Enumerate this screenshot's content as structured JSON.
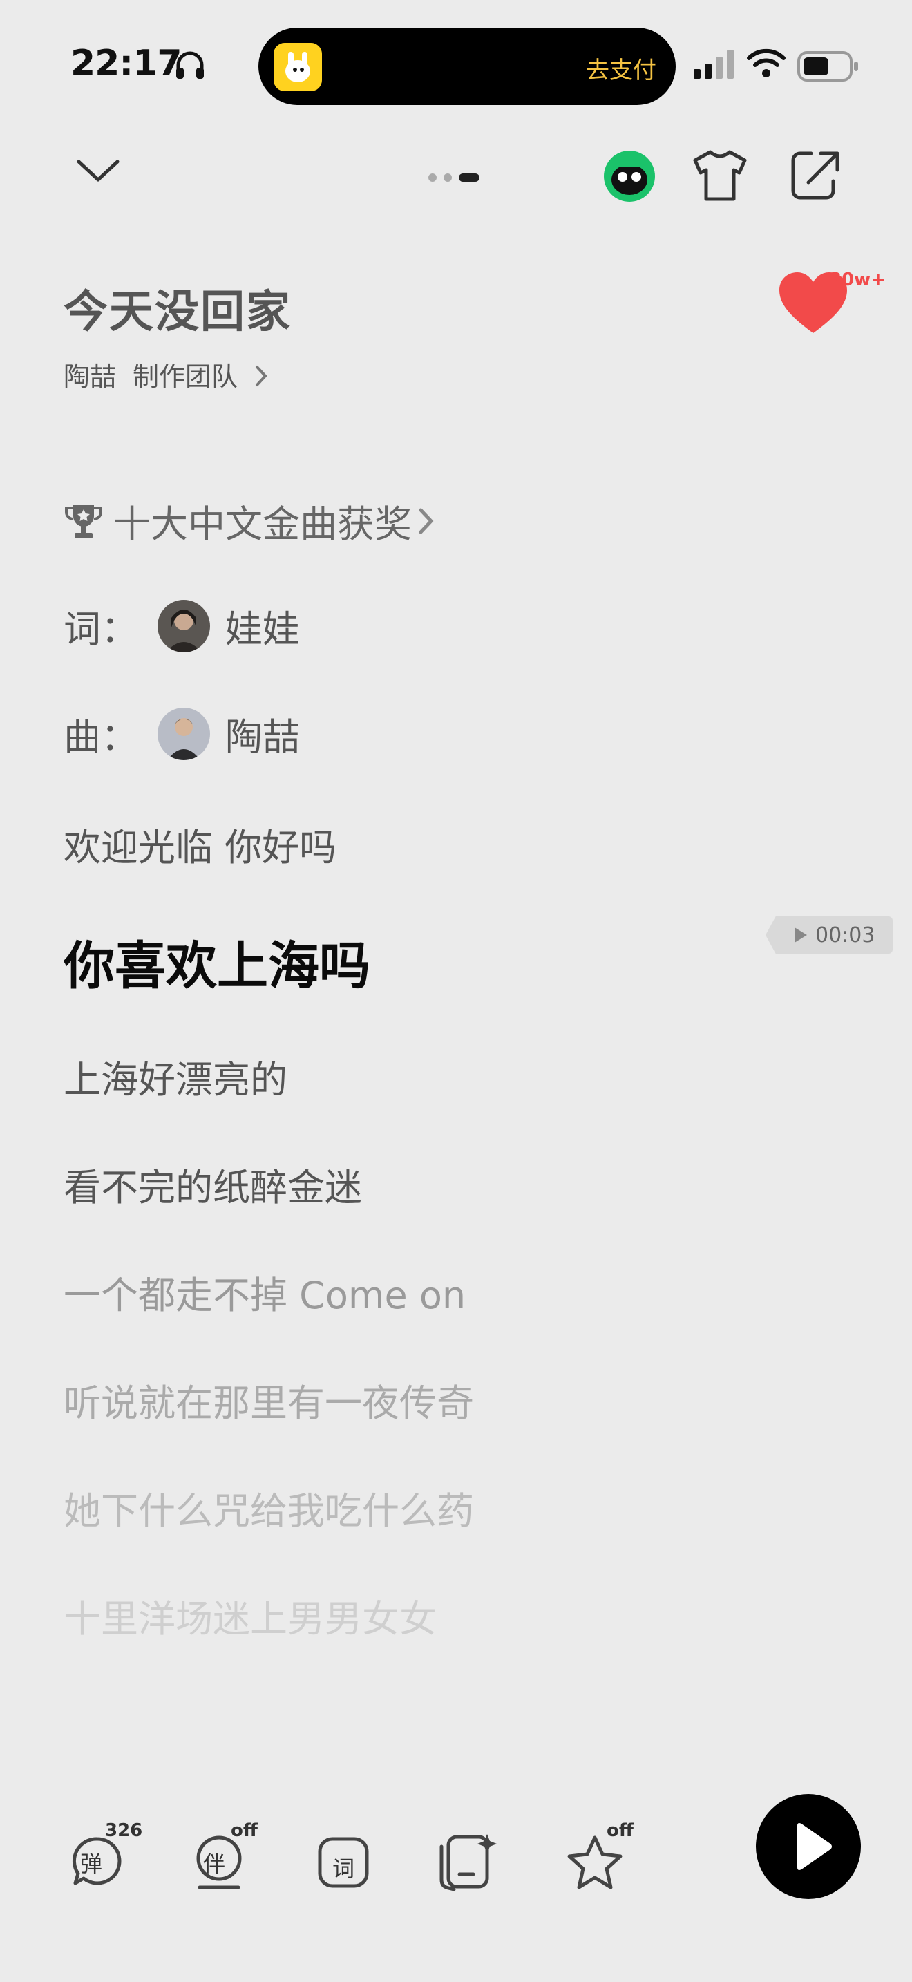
{
  "status_bar": {
    "time": "22:17",
    "island_pay_label": "去支付"
  },
  "song": {
    "title": "今天没回家",
    "artist": "陶喆",
    "team_label": "制作团队",
    "like_count": "30w+"
  },
  "award": {
    "label": "十大中文金曲获奖"
  },
  "credits": {
    "lyricist_prefix": "词：",
    "lyricist": "娃娃",
    "composer_prefix": "曲：",
    "composer": "陶喆"
  },
  "lyrics": {
    "before_active": [
      "欢迎光临 你好吗"
    ],
    "active": "你喜欢上海吗",
    "after_active": [
      "上海好漂亮的",
      "看不完的纸醉金迷",
      "一个都走不掉 Come on",
      "听说就在那里有一夜传奇",
      "她下什么咒给我吃什么药",
      "十里洋场迷上男男女女"
    ]
  },
  "seek_chip": {
    "time": "00:03"
  },
  "bottom_bar": {
    "danmaku_label": "弹",
    "danmaku_count": "326",
    "accompany_label": "伴",
    "accompany_state": "off",
    "lyrics_label": "词",
    "star_state": "off"
  },
  "colors": {
    "background": "#ebebeb",
    "heart": "#f24a4a",
    "island_pay": "#f5c342",
    "active_lyric": "#0b0b0b"
  }
}
